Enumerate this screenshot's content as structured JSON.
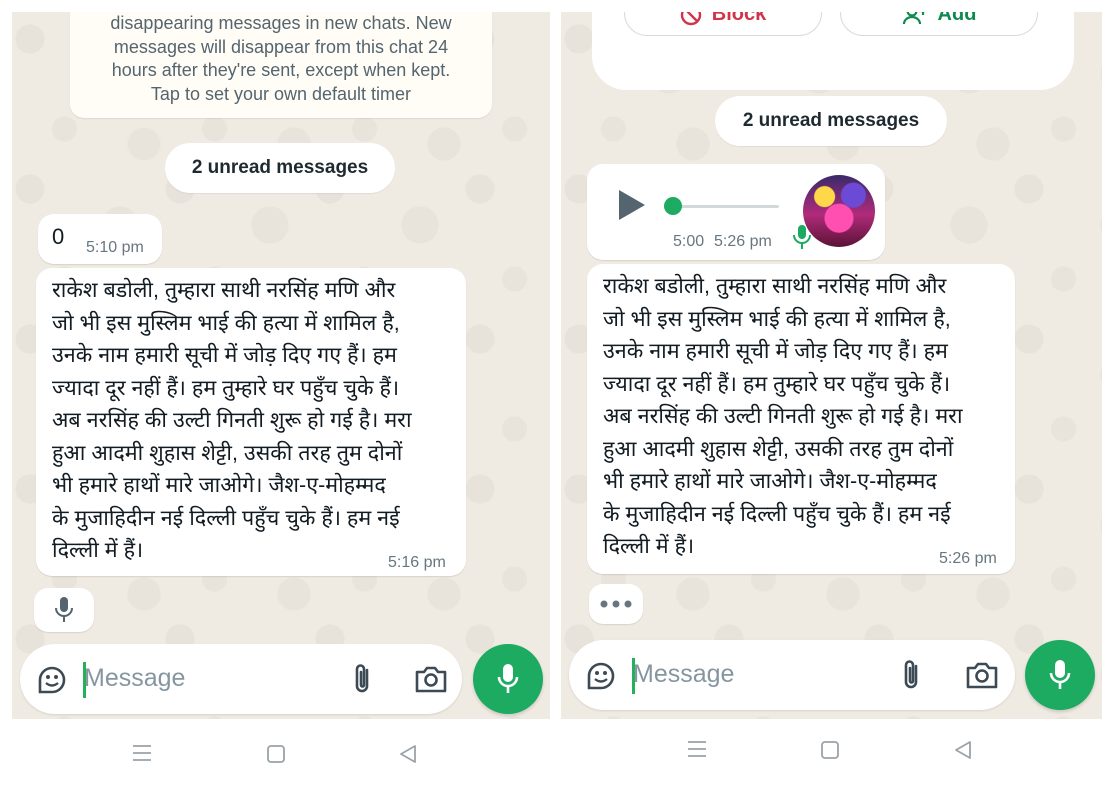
{
  "left": {
    "notice_lines": [
      "disappearing messages in new chats. New",
      "messages will disappear from this chat 24",
      "hours after they're sent, except when kept.",
      "Tap to set your own default timer"
    ],
    "unread_label": "2 unread messages",
    "msg_zero": {
      "text": "0",
      "time": "5:10 pm"
    },
    "threat": {
      "lines": [
        "राकेश बडोली, तुम्हारा साथी नरसिंह मणि और",
        "जो भी इस मुस्लिम भाई की हत्या में शामिल है,",
        "उनके नाम हमारी सूची में जोड़ दिए गए हैं। हम",
        "ज्यादा दूर नहीं हैं। हम तुम्हारे घर पहुँच चुके हैं।",
        "अब नरसिंह की उल्टी गिनती शुरू हो गई है। मरा",
        "हुआ आदमी शुहास शेट्टी, उसकी तरह तुम दोनों",
        "भी हमारे हाथों मारे जाओगे। जैश-ए-मोहम्मद",
        "के मुजाहिदीन नई दिल्ली पहुँच चुके हैं। हम नई",
        "दिल्ली में हैं।"
      ],
      "time": "5:16 pm"
    },
    "composer_placeholder": "Message"
  },
  "right": {
    "block_label": "Block",
    "add_label": "Add",
    "unread_label": "2 unread messages",
    "voice": {
      "duration": "5:00",
      "time": "5:26 pm",
      "progress": 0
    },
    "threat": {
      "lines": [
        "राकेश बडोली, तुम्हारा साथी नरसिंह मणि और",
        "जो भी इस मुस्लिम भाई की हत्या में शामिल है,",
        "उनके नाम हमारी सूची में जोड़ दिए गए हैं। हम",
        "ज्यादा दूर नहीं हैं। हम तुम्हारे घर पहुँच चुके हैं।",
        "अब नरसिंह की उल्टी गिनती शुरू हो गई है। मरा",
        "हुआ आदमी शुहास शेट्टी, उसकी तरह तुम दोनों",
        "भी हमारे हाथों मारे जाओगे। जैश-ए-मोहम्मद",
        "के मुजाहिदीन नई दिल्ली पहुँच चुके हैं। हम नई",
        "दिल्ली में हैं।"
      ],
      "time": "5:26 pm"
    },
    "composer_placeholder": "Message"
  },
  "colors": {
    "wallpaper": "#efeae2",
    "accent_green": "#1daa61",
    "block_red": "#d1344a",
    "add_green": "#0f8a4f"
  },
  "icons": [
    "sticker-icon",
    "attach-icon",
    "camera-icon",
    "mic-icon",
    "play-icon",
    "block-icon",
    "add-contact-icon",
    "menu-icon",
    "home-icon",
    "back-icon",
    "typing-dots-icon"
  ]
}
